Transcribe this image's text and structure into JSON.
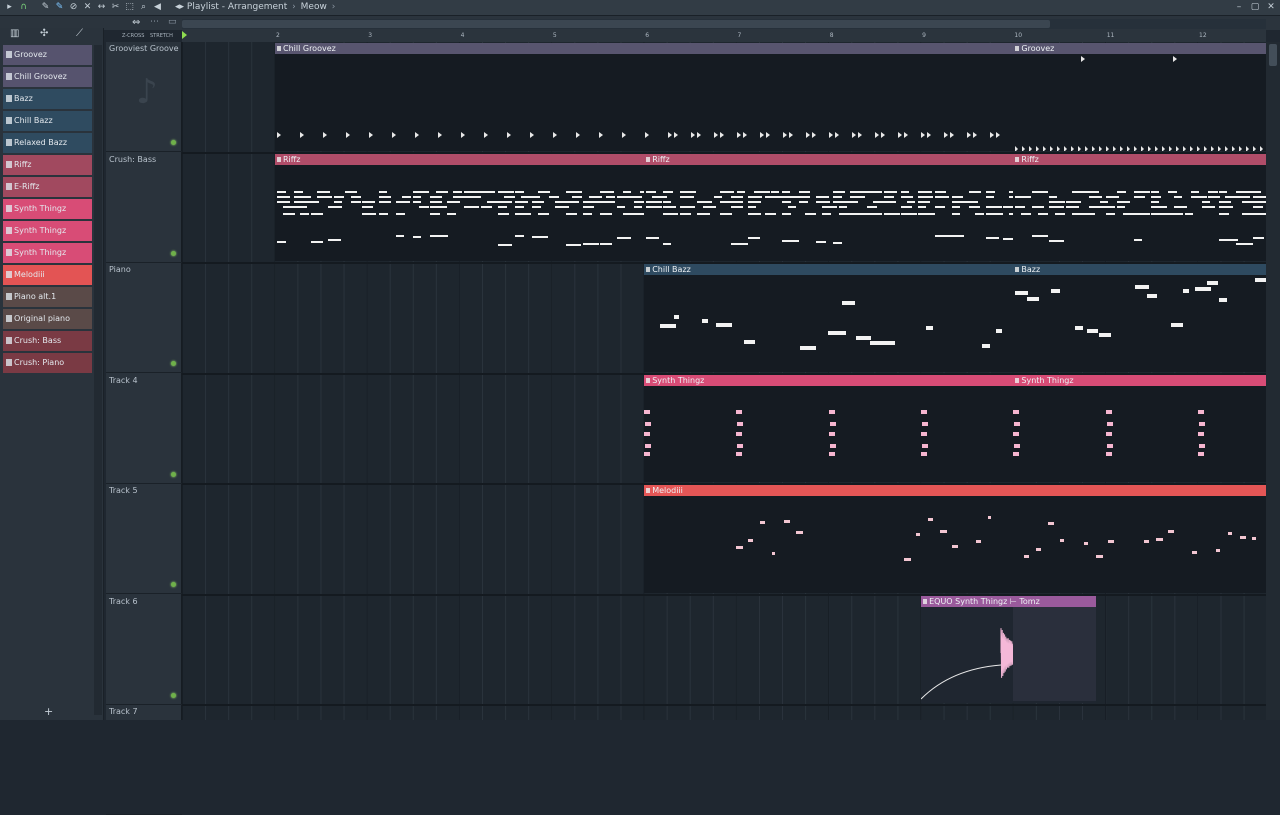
{
  "titlebar": {
    "title": "Playlist - Arrangement",
    "separator": "›",
    "song": "Meow",
    "end_sep": "›"
  },
  "toolbar": {
    "zcross": "Z-CROSS",
    "stretch": "STRETCH"
  },
  "patterns": [
    {
      "label": "Groovez",
      "color": "#56536e"
    },
    {
      "label": "Chill Groovez",
      "color": "#56536e"
    },
    {
      "label": "Bazz",
      "color": "#2f4b60"
    },
    {
      "label": "Chill Bazz",
      "color": "#2f4b60"
    },
    {
      "label": "Relaxed Bazz",
      "color": "#2f4b60"
    },
    {
      "label": "Riffz",
      "color": "#a1495f"
    },
    {
      "label": "E-Riffz",
      "color": "#a1495f"
    },
    {
      "label": "Synth Thingz",
      "color": "#d84c76"
    },
    {
      "label": "Synth Thingz",
      "color": "#d84c76"
    },
    {
      "label": "Synth Thingz",
      "color": "#d84c76"
    },
    {
      "label": "Melodiii",
      "color": "#e35454"
    },
    {
      "label": "Piano alt.1",
      "color": "#5a4a48"
    },
    {
      "label": "Original piano",
      "color": "#5a4a48"
    },
    {
      "label": "Crush: Bass",
      "color": "#7a3a44"
    },
    {
      "label": "Crush: Piano",
      "color": "#7a3a44"
    }
  ],
  "tracks": [
    "Grooviest Groove",
    "Crush: Bass",
    "Piano",
    "Track 4",
    "Track 5",
    "Track 6",
    "Track 7"
  ],
  "ruler": [
    "2",
    "3",
    "4",
    "5",
    "6",
    "7",
    "8",
    "9",
    "10",
    "11",
    "12"
  ],
  "clips": [
    {
      "label": "Chill Groovez",
      "color": "#58556f"
    },
    {
      "label": "Groovez",
      "color": "#58556f"
    },
    {
      "label": "Riffz",
      "color": "#b04d69"
    },
    {
      "label": "Riffz",
      "color": "#b04d69"
    },
    {
      "label": "Riffz",
      "color": "#b04d69"
    },
    {
      "label": "Chill Bazz",
      "color": "#2e4a60"
    },
    {
      "label": "Bazz",
      "color": "#2e4a60"
    },
    {
      "label": "Synth Thingz",
      "color": "#d84c76"
    },
    {
      "label": "Synth Thingz",
      "color": "#d84c76"
    },
    {
      "label": "Melodiii",
      "color": "#e45656"
    },
    {
      "label": "EQUO Synth Thingz ⊢ Tomz",
      "color": "#9a5a9c"
    }
  ]
}
